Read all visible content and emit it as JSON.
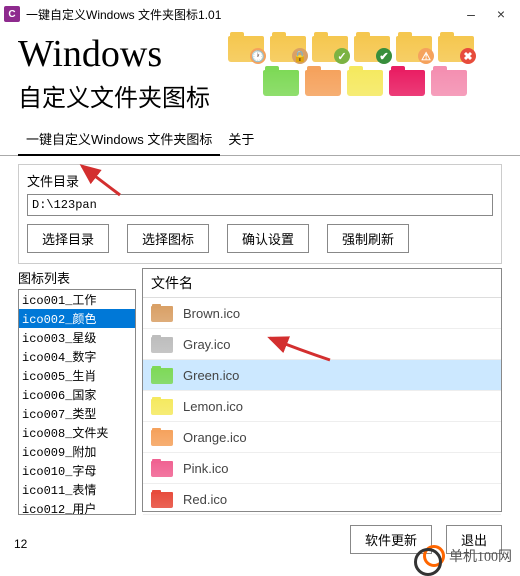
{
  "window": {
    "title": "一键自定义Windows 文件夹图标1.01",
    "minimize": "–",
    "close": "×"
  },
  "header": {
    "title1": "Windows",
    "title2": "自定义文件夹图标"
  },
  "tabs": {
    "main": "一键自定义Windows 文件夹图标",
    "about": "关于"
  },
  "panel": {
    "label": "文件目录",
    "path": "D:\\123pan",
    "btn_select_dir": "选择目录",
    "btn_select_icon": "选择图标",
    "btn_confirm": "确认设置",
    "btn_refresh": "强制刷新"
  },
  "icon_list": {
    "label": "图标列表",
    "items": [
      "ico001_工作",
      "ico002_颜色",
      "ico003_星级",
      "ico004_数字",
      "ico005_生肖",
      "ico006_国家",
      "ico007_类型",
      "ico008_文件夹",
      "ico009_附加",
      "ico010_字母",
      "ico011_表情",
      "ico012_用户"
    ],
    "selected_index": 1
  },
  "file_list": {
    "header": "文件名",
    "items": [
      {
        "name": "Brown.ico",
        "color": "#d9a066"
      },
      {
        "name": "Gray.ico",
        "color": "#bdbdbd"
      },
      {
        "name": "Green.ico",
        "color": "#7ed957"
      },
      {
        "name": "Lemon.ico",
        "color": "#f5e960"
      },
      {
        "name": "Orange.ico",
        "color": "#f5a25d"
      },
      {
        "name": "Pink.ico",
        "color": "#f06292"
      },
      {
        "name": "Red.ico",
        "color": "#e74c3c"
      }
    ],
    "selected_index": 2
  },
  "footer": {
    "update": "软件更新",
    "exit": "退出"
  },
  "status": "12",
  "watermark": "单机100网",
  "header_icons": {
    "row1": [
      {
        "color": "#f5c74f",
        "badge": "🕐",
        "badge_bg": "#f5a25d"
      },
      {
        "color": "#f5c74f",
        "badge": "🔒",
        "badge_bg": "#d9a066"
      },
      {
        "color": "#f5c74f",
        "badge": "✓",
        "badge_bg": "#7cb342"
      },
      {
        "color": "#f5c74f",
        "badge": "✔",
        "badge_bg": "#388e3c"
      },
      {
        "color": "#f5c74f",
        "badge": "⚠",
        "badge_bg": "#f5a25d"
      },
      {
        "color": "#f5c74f",
        "badge": "✖",
        "badge_bg": "#e74c3c"
      }
    ],
    "row2": [
      {
        "color": "#7ed957"
      },
      {
        "color": "#f5a25d"
      },
      {
        "color": "#f5e960"
      },
      {
        "color": "#e91e63"
      },
      {
        "color": "#f48fb1"
      }
    ]
  }
}
